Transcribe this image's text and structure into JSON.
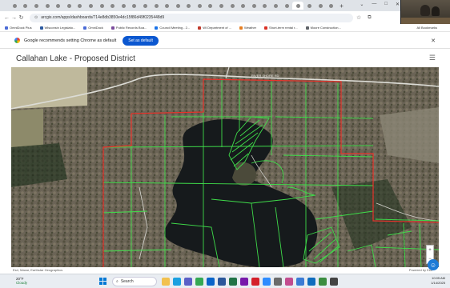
{
  "browser": {
    "tab_count": 30,
    "new_tab_label": "+",
    "window_controls": [
      "⌄",
      "—",
      "□",
      "✕"
    ],
    "url": "arcgis.com/apps/dashboards/714e8db3850e4dc15f86d49f0235448d9",
    "bookmarks": [
      {
        "label": "OmniDock Plus",
        "color": "#4a6bd6"
      },
      {
        "label": "Wisconsin Legislato...",
        "color": "#2c5aa0"
      },
      {
        "label": "OmniDock",
        "color": "#4a6bd6"
      },
      {
        "label": "Public Records Boa...",
        "color": "#7a4b9c"
      },
      {
        "label": "Council Meeting - 2...",
        "color": "#1a73e8"
      },
      {
        "label": "WI Department of ...",
        "color": "#c0392b"
      },
      {
        "label": "Weather",
        "color": "#e67e22"
      },
      {
        "label": "Short-term rental r...",
        "color": "#d93025"
      },
      {
        "label": "Moore Construction...",
        "color": "#5f6368"
      }
    ],
    "all_bookmarks_label": "All Bookmarks"
  },
  "infobar": {
    "message": "Google recommends setting Chrome as default",
    "button_label": "Set as default",
    "close": "✕"
  },
  "app": {
    "title": "Callahan Lake - Proposed District",
    "menu_icon": "☰"
  },
  "map": {
    "road_label": "RIVER SHORE RD",
    "credit": "Esri, Maxar, Earthstar Geographics",
    "powered": "Powered by Esri",
    "zoom_in": "+",
    "zoom_out": "−",
    "colors": {
      "parcel": "#3fdc4a",
      "district": "#e8332b",
      "road": "#d9d9d4"
    }
  },
  "taskbar": {
    "weather_temp": "20°F",
    "weather_sub": "Cloudy",
    "search_placeholder": "Search",
    "icons": [
      {
        "name": "file-explorer-icon",
        "color": "#f2c14e"
      },
      {
        "name": "edge-icon",
        "color": "#1aa0e0"
      },
      {
        "name": "teams-icon",
        "color": "#5b5fc7"
      },
      {
        "name": "chrome-icon",
        "color": "#34a853"
      },
      {
        "name": "outlook-icon",
        "color": "#0a64c9"
      },
      {
        "name": "word-icon",
        "color": "#2b579a"
      },
      {
        "name": "excel-icon",
        "color": "#217346"
      },
      {
        "name": "onenote-icon",
        "color": "#7719aa"
      },
      {
        "name": "acrobat-icon",
        "color": "#d4202a"
      },
      {
        "name": "zoom-icon",
        "color": "#2d8cff"
      },
      {
        "name": "settings-icon",
        "color": "#6b6b6b"
      },
      {
        "name": "photos-icon",
        "color": "#c24c8f"
      },
      {
        "name": "store-icon",
        "color": "#3b7bd4"
      },
      {
        "name": "mail-icon",
        "color": "#0f6cbd"
      },
      {
        "name": "calendar-icon",
        "color": "#3c8d40"
      },
      {
        "name": "camera-icon",
        "color": "#444444"
      }
    ],
    "time": "10:05 AM",
    "date": "1/14/2025"
  }
}
